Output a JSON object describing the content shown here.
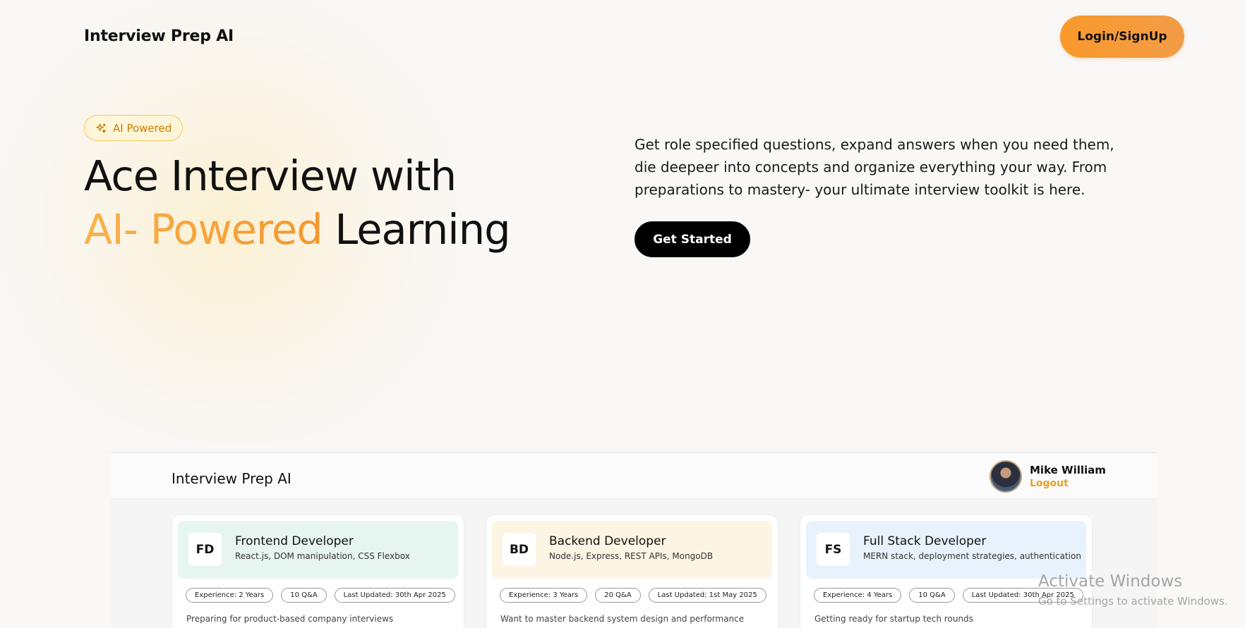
{
  "nav": {
    "brand": "Interview Prep AI",
    "login_label": "Login/SignUp"
  },
  "hero": {
    "badge_icon": "sparkles-icon",
    "badge_label": "AI Powered",
    "title_line1": "Ace Interview with",
    "title_accent": "AI- Powered",
    "title_line2_rest": " Learning",
    "description": "Get role specified questions, expand answers when you need them, die deepeer into concepts and organize everything your way. From preparations to mastery- your ultimate interview toolkit is here.",
    "cta_label": "Get Started",
    "accent_color": "#f79a30"
  },
  "preview": {
    "brand": "Interview Prep AI",
    "user_name": "Mike William",
    "logout_label": "Logout",
    "cards": [
      {
        "abbr": "FD",
        "title": "Frontend Developer",
        "skills": "React.js, DOM manipulation, CSS Flexbox",
        "tags": [
          "Experience: 2 Years",
          "10 Q&A",
          "Last Updated: 30th Apr 2025"
        ],
        "description": "Preparing for product-based company interviews",
        "color": "#e6f5ef"
      },
      {
        "abbr": "BD",
        "title": "Backend Developer",
        "skills": "Node.js, Express, REST APIs, MongoDB",
        "tags": [
          "Experience: 3 Years",
          "20 Q&A",
          "Last Updated: 1st May 2025"
        ],
        "description": "Want to master backend system design and performance",
        "color": "#fdf5e3"
      },
      {
        "abbr": "FS",
        "title": "Full Stack Developer",
        "skills": "MERN stack, deployment strategies, authentication",
        "tags": [
          "Experience: 4 Years",
          "10 Q&A",
          "Last Updated: 30th Apr 2025"
        ],
        "description": "Getting ready for startup tech rounds",
        "color": "#e7f2fc"
      }
    ]
  },
  "watermark": {
    "title": "Activate Windows",
    "subtitle": "Go to Settings to activate Windows."
  }
}
